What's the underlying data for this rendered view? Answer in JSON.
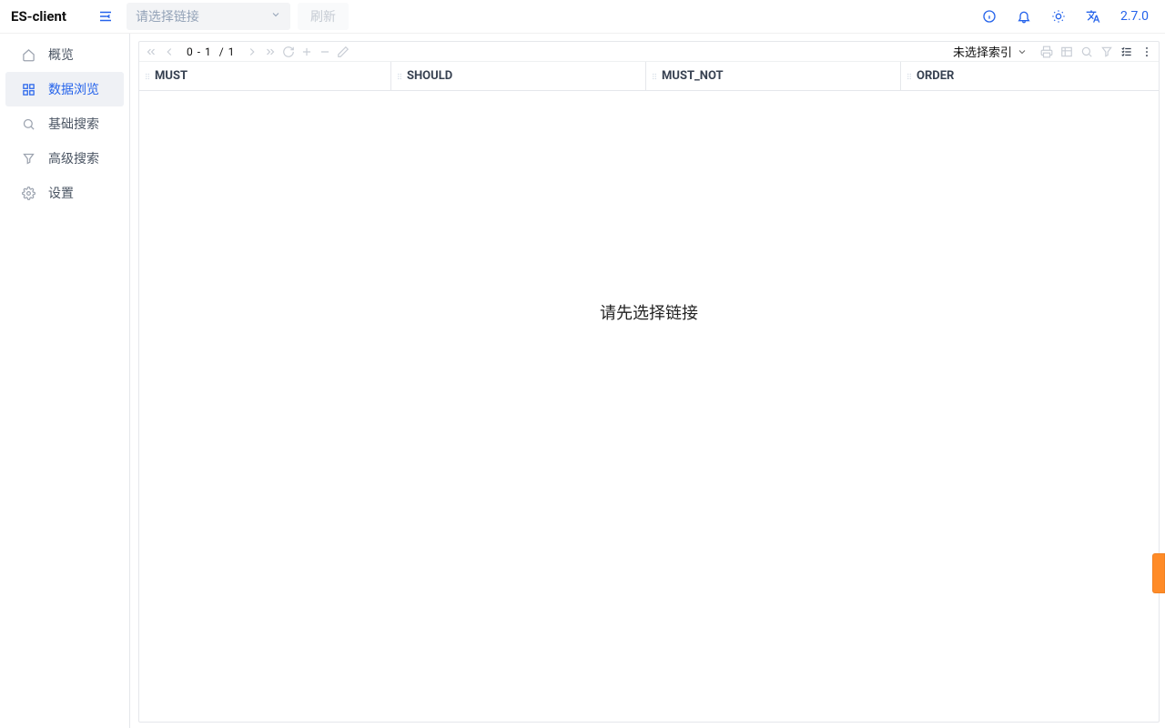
{
  "header": {
    "logo": "ES-client",
    "select_placeholder": "请选择链接",
    "refresh_label": "刷新",
    "version": "2.7.0"
  },
  "sidebar": {
    "items": [
      {
        "label": "概览",
        "icon": "home-icon",
        "active": false
      },
      {
        "label": "数据浏览",
        "icon": "grid-icon",
        "active": true
      },
      {
        "label": "基础搜索",
        "icon": "search-icon",
        "active": false
      },
      {
        "label": "高级搜索",
        "icon": "filter-icon",
        "active": false
      },
      {
        "label": "设置",
        "icon": "gear-icon",
        "active": false
      }
    ]
  },
  "toolbar": {
    "page_range": "0 - 1",
    "page_sep": "/",
    "page_total": "1",
    "index_selector": "未选择索引"
  },
  "columns": [
    {
      "label": "MUST"
    },
    {
      "label": "SHOULD"
    },
    {
      "label": "MUST_NOT"
    },
    {
      "label": "ORDER"
    }
  ],
  "empty_message": "请先选择链接",
  "colors": {
    "primary": "#2563eb",
    "accent": "#ff8b27"
  }
}
